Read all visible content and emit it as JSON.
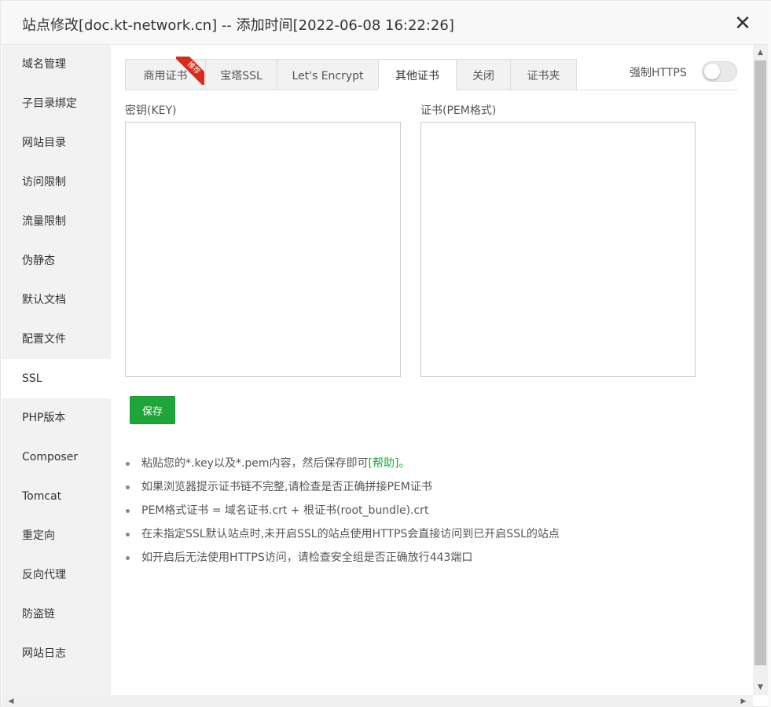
{
  "window": {
    "title": "站点修改[doc.kt-network.cn] -- 添加时间[2022-06-08 16:22:26]",
    "close_icon": "close-icon"
  },
  "sidebar": {
    "items": [
      {
        "label": "域名管理"
      },
      {
        "label": "子目录绑定"
      },
      {
        "label": "网站目录"
      },
      {
        "label": "访问限制"
      },
      {
        "label": "流量限制"
      },
      {
        "label": "伪静态"
      },
      {
        "label": "默认文档"
      },
      {
        "label": "配置文件"
      },
      {
        "label": "SSL",
        "active": true
      },
      {
        "label": "PHP版本"
      },
      {
        "label": "Composer"
      },
      {
        "label": "Tomcat"
      },
      {
        "label": "重定向"
      },
      {
        "label": "反向代理"
      },
      {
        "label": "防盗链"
      },
      {
        "label": "网站日志"
      }
    ]
  },
  "tabs": [
    {
      "label": "商用证书",
      "badge": "推荐"
    },
    {
      "label": "宝塔SSL"
    },
    {
      "label": "Let's Encrypt"
    },
    {
      "label": "其他证书",
      "active": true
    },
    {
      "label": "关闭"
    },
    {
      "label": "证书夹"
    }
  ],
  "force_https": {
    "label": "强制HTTPS",
    "enabled": false
  },
  "key_field": {
    "label": "密钥(KEY)",
    "value": ""
  },
  "cert_field": {
    "label": "证书(PEM格式)",
    "value": ""
  },
  "save_button": {
    "label": "保存"
  },
  "tips": [
    {
      "text": "粘贴您的*.key以及*.pem内容，然后保存即可",
      "link": "[帮助]",
      "suffix": "。"
    },
    {
      "text": "如果浏览器提示证书链不完整,请检查是否正确拼接PEM证书"
    },
    {
      "text": "PEM格式证书 = 域名证书.crt + 根证书(root_bundle).crt"
    },
    {
      "text": "在未指定SSL默认站点时,未开启SSL的站点使用HTTPS会直接访问到已开启SSL的站点"
    },
    {
      "text": "如开启后无法使用HTTPS访问，请检查安全组是否正确放行443端口"
    }
  ],
  "colors": {
    "accent_green": "#20a53a",
    "ribbon_red": "#d32d1e"
  }
}
